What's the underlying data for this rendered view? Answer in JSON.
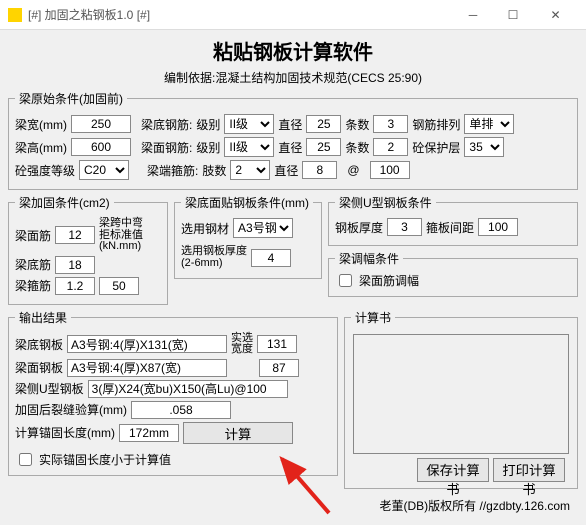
{
  "window": {
    "title": "[#] 加固之粘钢板1.0 [#]"
  },
  "header": {
    "title": "粘贴钢板计算软件",
    "basis": "编制依据:混凝土结构加固技术规范(CECS 25:90)"
  },
  "original": {
    "legend": "梁原始条件(加固前)",
    "beam_width_lbl": "梁宽(mm)",
    "beam_width": "250",
    "beam_height_lbl": "梁高(mm)",
    "beam_height": "600",
    "conc_grade_lbl": "砼强度等级",
    "conc_grade": "C20",
    "bottom_rebar_lbl": "梁底钢筋:",
    "grade_lbl": "级别",
    "diam_lbl": "直径",
    "count_lbl": "条数",
    "bottom_grade": "II级",
    "bottom_diam": "25",
    "bottom_count": "3",
    "layout_lbl": "钢筋排列",
    "layout": "单排",
    "top_rebar_lbl": "梁面钢筋:",
    "top_grade": "II级",
    "top_diam": "25",
    "top_count": "2",
    "cover_lbl": "砼保护层",
    "cover": "35",
    "stirrup_lbl": "梁端箍筋:",
    "legs_lbl": "肢数",
    "legs": "2",
    "stirrup_diam": "8",
    "at": "@",
    "spacing": "100"
  },
  "reinforce": {
    "legend": "梁加固条件(cm2)",
    "top_lbl": "梁面筋",
    "top_val": "12",
    "bottom_lbl": "梁底筋",
    "bottom_val": "18",
    "stirrup_lbl": "梁箍筋",
    "stirrup_val": "1.2",
    "stirrup_val2": "50",
    "bending_lbl1": "梁跨中弯",
    "bending_lbl2": "拒标准值",
    "bending_lbl3": "(kN.mm)"
  },
  "plate": {
    "legend": "梁底面贴钢板条件(mm)",
    "steel_lbl": "选用钢材",
    "steel_sel": "A3号钢",
    "thick_lbl1": "选用钢板厚度",
    "thick_lbl2": "(2-6mm)",
    "thick": "4"
  },
  "side": {
    "legend": "梁侧U型钢板条件",
    "thick_lbl": "钢板厚度",
    "thick": "3",
    "spacing_lbl": "箍板间距",
    "spacing": "100"
  },
  "adjust": {
    "legend": "梁调幅条件",
    "chk_lbl": "梁面筋调幅"
  },
  "output": {
    "legend": "输出结果",
    "bottom_plate_lbl": "梁底钢板",
    "bottom_plate": "A3号钢:4(厚)X131(宽)",
    "top_plate_lbl": "梁面钢板",
    "top_plate": "A3号钢:4(厚)X87(宽)",
    "real_lbl1": "实选",
    "real_lbl2": "宽度",
    "real_bottom": "131",
    "real_top": "87",
    "u_lbl": "梁侧U型钢板",
    "u_val": "3(厚)X24(宽bu)X150(高Lu)@100",
    "crack_lbl": "加固后裂缝验算(mm)",
    "crack": ".058",
    "anchor_lbl": "计算锚固长度(mm)",
    "anchor": "172mm",
    "calc_btn": "计算",
    "chk_lbl": "实际锚固长度小于计算值"
  },
  "calcbook": {
    "legend": "计算书",
    "save_btn": "保存计算书",
    "print_btn": "打印计算书"
  },
  "footer": "老董(DB)版权所有 //gzdbty.126.com"
}
